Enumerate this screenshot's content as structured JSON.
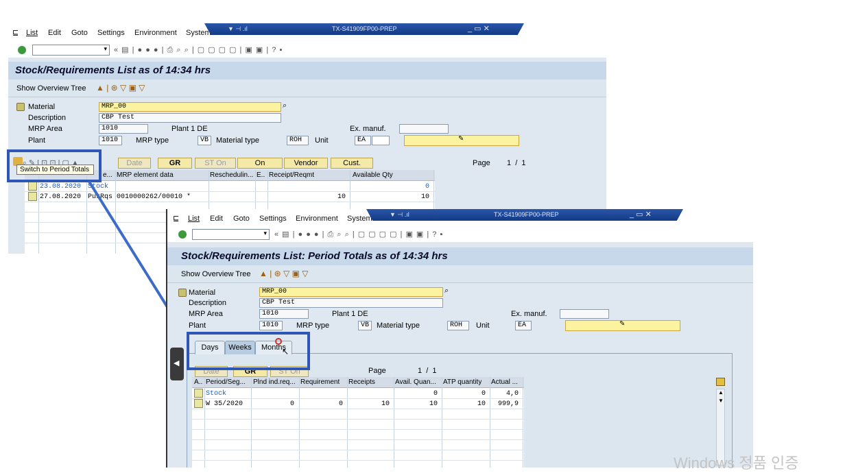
{
  "window1": {
    "menu": [
      "List",
      "Edit",
      "Goto",
      "Settings",
      "Environment",
      "System"
    ],
    "title": "TX-S41909FP00-PREP",
    "heading": "Stock/Requirements List as of 14:34 hrs",
    "app_toolbar_label": "Show Overview Tree",
    "form": {
      "material_label": "Material",
      "material_value": "MRP_00",
      "description_label": "Description",
      "description_value": "CBP Test",
      "mrp_area_label": "MRP Area",
      "mrp_area_value": "1010",
      "plant_text": "Plant 1 DE",
      "ex_manuf_label": "Ex. manuf.",
      "plant_label": "Plant",
      "plant_value": "1010",
      "mrp_type_label": "MRP type",
      "mrp_type_value": "VB",
      "material_type_label": "Material type",
      "material_type_value": "ROH",
      "unit_label": "Unit",
      "unit_value": "EA"
    },
    "buttons": {
      "date": "Date",
      "gr": "GR",
      "st_on": "ST On",
      "on": "On",
      "vendor": "Vendor",
      "cust": "Cust."
    },
    "page_label": "Page",
    "page_value": "1  /  1",
    "tooltip": "Switch to Period Totals",
    "columns": [
      "",
      "e...",
      "MRP element data",
      "Reschedulin...",
      "E..",
      "Receipt/Reqmt",
      "Available Qty"
    ],
    "rows": [
      {
        "date": "23.08.2020",
        "elem": "Stock",
        "data": "",
        "receipt": "",
        "avail": "0"
      },
      {
        "date": "27.08.2020",
        "elem": "PurRqs",
        "data": "0010000262/00010 *",
        "receipt": "10",
        "avail": "10"
      }
    ]
  },
  "window2": {
    "menu": [
      "List",
      "Edit",
      "Goto",
      "Settings",
      "Environment",
      "System"
    ],
    "title": "TX-S41909FP00-PREP",
    "heading": "Stock/Requirements List: Period Totals as of 14:34 hrs",
    "app_toolbar_label": "Show Overview Tree",
    "form": {
      "material_label": "Material",
      "material_value": "MRP_00",
      "description_label": "Description",
      "description_value": "CBP Test",
      "mrp_area_label": "MRP Area",
      "mrp_area_value": "1010",
      "plant_text": "Plant 1 DE",
      "ex_manuf_label": "Ex. manuf.",
      "plant_label": "Plant",
      "plant_value": "1010",
      "mrp_type_label": "MRP type",
      "mrp_type_value": "VB",
      "material_type_label": "Material type",
      "material_type_value": "ROH",
      "unit_label": "Unit",
      "unit_value": "EA"
    },
    "tabs": [
      "Days",
      "Weeks",
      "Months"
    ],
    "buttons": {
      "date": "Date",
      "gr": "GR",
      "st_on": "ST On"
    },
    "page_label": "Page",
    "page_value": "1  /  1",
    "columns": [
      "A..",
      "Period/Seg...",
      "Plnd ind.req...",
      "Requirement",
      "Receipts",
      "Avail. Quan...",
      "ATP quantity",
      "Actual ..."
    ],
    "rows": [
      {
        "period": "Stock",
        "plnd": "",
        "req": "",
        "rec": "",
        "avail": "0",
        "atp": "0",
        "actual": "4,0"
      },
      {
        "period": "W 35/2020",
        "plnd": "0",
        "req": "0",
        "rec": "10",
        "avail": "10",
        "atp": "10",
        "actual": "999,9"
      }
    ]
  },
  "watermark": "Windows 정품 인증",
  "colors": {
    "highlight": "#2d56b5",
    "title_bar": "#1c448f",
    "input_yellow": "#fbf3a0"
  }
}
